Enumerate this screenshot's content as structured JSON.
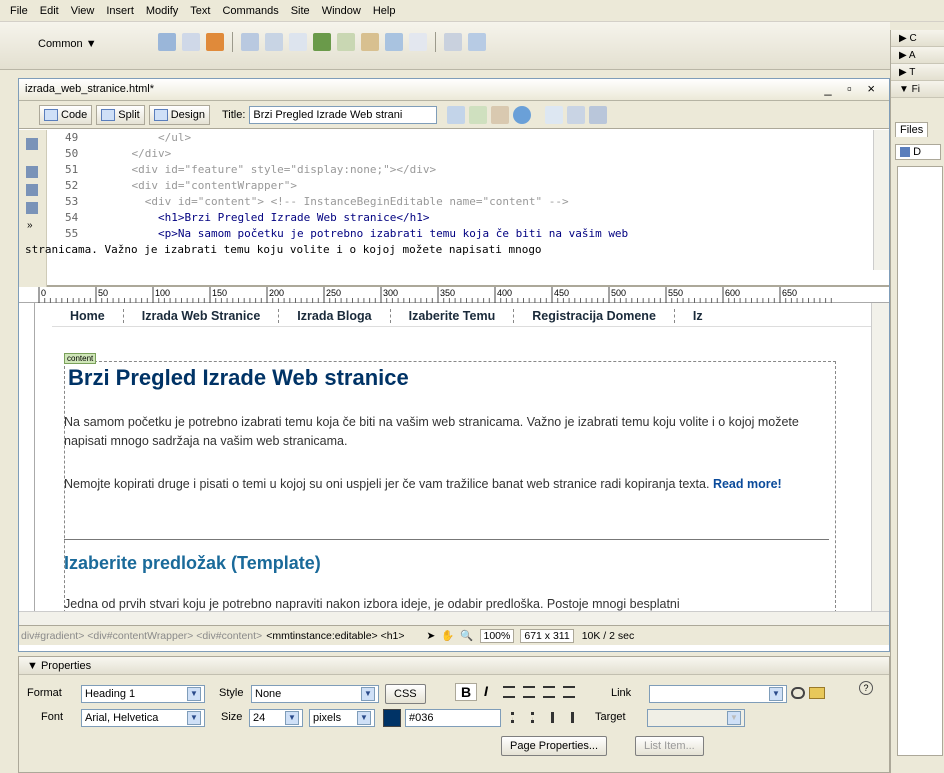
{
  "menu": [
    "File",
    "Edit",
    "View",
    "Insert",
    "Modify",
    "Text",
    "Commands",
    "Site",
    "Window",
    "Help"
  ],
  "insert_bar": {
    "category": "Common"
  },
  "document": {
    "tab": "izrada_web_stranice.html*",
    "window_controls": "_ ▫ ×",
    "views": {
      "code": "Code",
      "split": "Split",
      "design": "Design"
    },
    "title_label": "Title:",
    "title_value": "Brzi Pregled Izrade Web strani"
  },
  "code": {
    "lines": [
      {
        "num": "49",
        "text": "        </ul>"
      },
      {
        "num": "50",
        "text": "    </div>"
      },
      {
        "num": "51",
        "text": "    <div id=\"feature\" style=\"display:none;\"></div>"
      },
      {
        "num": "52",
        "text": "    <div id=\"contentWrapper\">"
      },
      {
        "num": "53",
        "text": "      <div id=\"content\"> <!-- InstanceBeginEditable name=\"content\" -->"
      },
      {
        "num": "54",
        "text": "        <h1>Brzi Pregled Izrade Web stranice</h1>"
      },
      {
        "num": "55",
        "text": "        <p>Na samom početku je potrebno izabrati temu koja če biti na vašim web"
      },
      {
        "num": "",
        "text": "stranicama. Važno je izabrati temu koju volite i o kojoj možete napisati mnogo"
      }
    ]
  },
  "ruler_ticks": [
    "0",
    "50",
    "100",
    "150",
    "200",
    "250",
    "300",
    "350",
    "400",
    "450",
    "500",
    "550",
    "600",
    "650"
  ],
  "design": {
    "nav": [
      "Home",
      "Izrada Web Stranice",
      "Izrada Bloga",
      "Izaberite Temu",
      "Registracija Domene",
      "Iz"
    ],
    "content_tag": "content",
    "h1": "Brzi Pregled Izrade Web stranice",
    "p1": "Na samom početku je potrebno izabrati temu koja če biti na vašim web stranicama. Važno je izabrati temu koju volite i o kojoj možete napisati mnogo sadržaja na vašim web stranicama.",
    "p2": "Nemojte kopirati druge i pisati o temi u kojoj su oni uspjeli jer če vam tražilice banat web stranice radi kopiranja texta.",
    "read_more": "Read more!",
    "h2": "Izaberite predložak (Template)",
    "p3": "Jedna od prvih stvari koju je potrebno napraviti nakon izbora ideje, je odabir predloška. Postoje mnogi besplatni"
  },
  "status": {
    "tag_path_dim": "div#gradient> <div#contentWrapper> <div#content>",
    "tag_path_active": "<mmtinstance:editable> <h1>",
    "zoom": "100%",
    "dimensions": "671 x 311",
    "size": "10K / 2 sec"
  },
  "properties": {
    "header": "Properties",
    "format_label": "Format",
    "format_value": "Heading 1",
    "style_label": "Style",
    "style_value": "None",
    "css_button": "CSS",
    "bold": "B",
    "italic": "I",
    "link_label": "Link",
    "font_label": "Font",
    "font_value": "Arial, Helvetica",
    "size_label": "Size",
    "size_value": "24",
    "units_value": "pixels",
    "color_value": "#036",
    "color_swatch": "#003366",
    "target_label": "Target",
    "page_properties": "Page Properties...",
    "list_item": "List Item..."
  },
  "right_panel": {
    "rows": [
      "▶ C",
      "▶ A",
      "▶ T",
      "▼ Fi"
    ],
    "files_tab": "Files",
    "files_label": "D"
  }
}
